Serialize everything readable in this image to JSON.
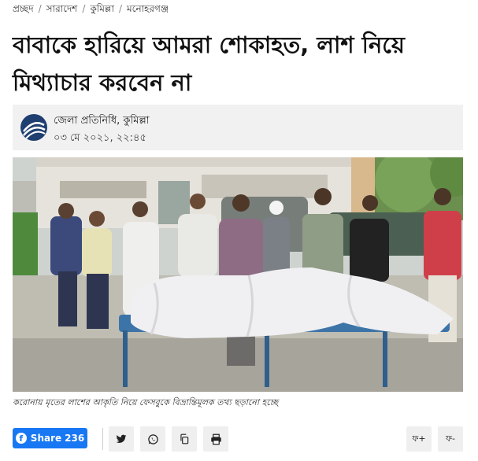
{
  "breadcrumb": {
    "items": [
      "প্রচ্ছদ",
      "সারাদেশ",
      "কুমিল্লা",
      "মনোহরগঞ্জ"
    ],
    "separator": "/"
  },
  "article": {
    "title": "বাবাকে হারিয়ে আমরা শোকাহত, লাশ নিয়ে মিথ্যাচার করবেন না",
    "author": "জেলা প্রতিনিধি, কুমিল্লা",
    "published": "০৩ মে ২০২১, ২২:৪৫",
    "photo_caption": "করোনায় মৃতের লাশের আকৃতি নিয়ে ফেসবুকে বিভ্রান্তিমূলক তথ্য ছড়ানো হচ্ছে"
  },
  "share": {
    "facebook_label": "Share",
    "facebook_count": "236",
    "icons": [
      "twitter-icon",
      "whatsapp-icon",
      "copy-icon",
      "print-icon"
    ],
    "font_increase": "ফ+",
    "font_decrease": "ফ-"
  },
  "colors": {
    "facebook": "#1877f2",
    "author_box": "#f1f1f1",
    "logo": "#1f3f70"
  }
}
